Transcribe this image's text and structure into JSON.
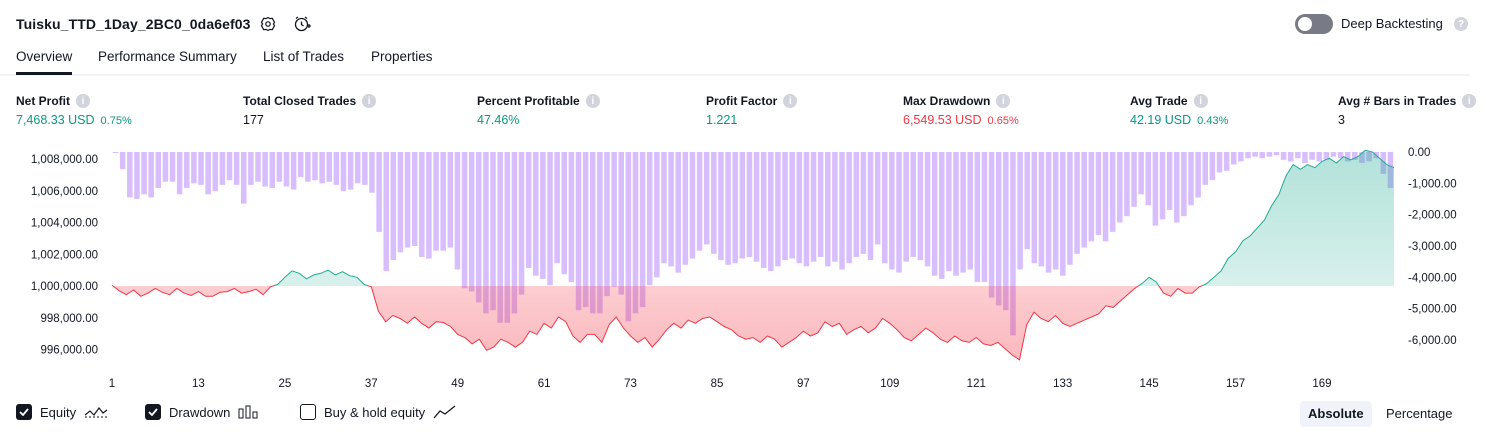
{
  "header": {
    "title": "Tuisku_TTD_1Day_2BC0_0da6ef03",
    "deep_backtesting_label": "Deep Backtesting"
  },
  "tabs": [
    {
      "label": "Overview",
      "active": true
    },
    {
      "label": "Performance Summary",
      "active": false
    },
    {
      "label": "List of Trades",
      "active": false
    },
    {
      "label": "Properties",
      "active": false
    }
  ],
  "metrics": [
    {
      "label": "Net Profit",
      "value": "7,468.33 USD",
      "pct": "0.75%",
      "color": "green"
    },
    {
      "label": "Total Closed Trades",
      "value": "177",
      "pct": "",
      "color": "dark"
    },
    {
      "label": "Percent Profitable",
      "value": "47.46%",
      "pct": "",
      "color": "green"
    },
    {
      "label": "Profit Factor",
      "value": "1.221",
      "pct": "",
      "color": "green"
    },
    {
      "label": "Max Drawdown",
      "value": "6,549.53 USD",
      "pct": "0.65%",
      "color": "red"
    },
    {
      "label": "Avg Trade",
      "value": "42.19 USD",
      "pct": "0.43%",
      "color": "green"
    },
    {
      "label": "Avg # Bars in Trades",
      "value": "3",
      "pct": "",
      "color": "dark"
    }
  ],
  "chart_data": {
    "type": "area",
    "baseline": 1000000,
    "left_axis": {
      "labels": [
        "1,008,000.00",
        "1,006,000.00",
        "1,004,000.00",
        "1,002,000.00",
        "1,000,000.00",
        "998,000.00",
        "996,000.00"
      ],
      "values": [
        1008000,
        1006000,
        1004000,
        1002000,
        1000000,
        998000,
        996000
      ]
    },
    "right_axis": {
      "labels": [
        "0.00",
        "-1,000.00",
        "-2,000.00",
        "-3,000.00",
        "-4,000.00",
        "-5,000.00",
        "-6,000.00"
      ],
      "values": [
        0,
        -1000,
        -2000,
        -3000,
        -4000,
        -5000,
        -6000
      ]
    },
    "x_ticks": [
      "1",
      "13",
      "25",
      "37",
      "49",
      "61",
      "73",
      "85",
      "97",
      "109",
      "121",
      "133",
      "145",
      "157",
      "169"
    ],
    "equity": [
      1000050,
      999700,
      999450,
      999750,
      999350,
      999550,
      999850,
      999600,
      999450,
      999850,
      999550,
      999400,
      999650,
      999350,
      999350,
      999600,
      999650,
      999850,
      999550,
      999650,
      999800,
      999450,
      999950,
      1000100,
      1000550,
      1000950,
      1000800,
      1000450,
      1000700,
      1000800,
      1001000,
      1000700,
      1000900,
      1000650,
      1000550,
      1000100,
      999950,
      998400,
      997750,
      998150,
      997950,
      997650,
      998050,
      997650,
      997350,
      997750,
      997700,
      997450,
      996950,
      996750,
      996350,
      996650,
      995950,
      996150,
      996650,
      996450,
      996150,
      996450,
      997150,
      996950,
      997650,
      997350,
      998050,
      997750,
      996850,
      996450,
      996950,
      996950,
      996450,
      997550,
      998050,
      997350,
      996850,
      996450,
      996750,
      996150,
      996650,
      997250,
      997650,
      997350,
      997850,
      997650,
      997950,
      998050,
      997750,
      997450,
      997250,
      996850,
      996650,
      996750,
      996450,
      996850,
      996650,
      996150,
      996450,
      996750,
      997150,
      996850,
      997050,
      997750,
      997450,
      997650,
      996950,
      997250,
      997450,
      997050,
      997350,
      997950,
      997650,
      997250,
      996750,
      996550,
      996950,
      997350,
      997050,
      996650,
      996450,
      996850,
      996550,
      996450,
      996750,
      996350,
      996250,
      996450,
      996050,
      995650,
      995350,
      997550,
      998350,
      997950,
      997750,
      998150,
      997650,
      997450,
      997650,
      997850,
      998050,
      998250,
      998750,
      998650,
      999050,
      999450,
      999850,
      1000150,
      1000550,
      1000250,
      999550,
      999350,
      999850,
      999550,
      999550,
      999950,
      1000150,
      1000550,
      1000950,
      1001750,
      1002150,
      1002850,
      1003150,
      1003650,
      1004150,
      1005050,
      1005750,
      1006950,
      1007650,
      1007350,
      1007650,
      1007450,
      1007850,
      1008050,
      1007750,
      1008150,
      1007950,
      1008150,
      1008550,
      1008450,
      1008050,
      1007650,
      1007450
    ],
    "drawdown": [
      0,
      -550,
      -1450,
      -1500,
      -1350,
      -1450,
      -1150,
      -950,
      -950,
      -1350,
      -1150,
      -1000,
      -1050,
      -1350,
      -1250,
      -1050,
      -900,
      -1050,
      -1650,
      -1050,
      -950,
      -1100,
      -1150,
      -950,
      -1100,
      -1200,
      -800,
      -950,
      -900,
      -1000,
      -950,
      -1050,
      -1250,
      -1200,
      -1000,
      -1050,
      -1300,
      -2550,
      -3800,
      -3450,
      -3200,
      -3050,
      -3000,
      -3350,
      -3400,
      -3150,
      -3150,
      -3050,
      -3750,
      -4350,
      -4450,
      -4800,
      -5150,
      -5050,
      -5450,
      -5450,
      -5150,
      -4550,
      -3700,
      -3950,
      -4050,
      -4250,
      -3550,
      -3900,
      -4150,
      -5050,
      -4950,
      -5150,
      -5150,
      -4600,
      -4300,
      -4550,
      -5400,
      -5150,
      -4950,
      -4250,
      -4000,
      -3550,
      -3650,
      -3850,
      -3600,
      -3400,
      -3150,
      -2950,
      -3250,
      -3450,
      -3600,
      -3550,
      -3400,
      -3350,
      -3500,
      -3700,
      -3800,
      -3650,
      -3450,
      -3400,
      -3550,
      -3650,
      -3500,
      -3350,
      -3650,
      -3500,
      -3750,
      -3550,
      -3350,
      -3250,
      -3450,
      -2950,
      -3550,
      -3750,
      -3850,
      -3500,
      -3350,
      -3450,
      -3650,
      -3950,
      -4050,
      -3800,
      -3950,
      -3850,
      -3750,
      -4150,
      -4150,
      -4650,
      -4900,
      -5050,
      -5850,
      -3750,
      -3100,
      -3550,
      -3650,
      -3850,
      -3750,
      -3950,
      -3600,
      -3250,
      -3050,
      -2850,
      -2650,
      -2850,
      -2550,
      -2250,
      -2050,
      -1750,
      -1350,
      -1700,
      -2350,
      -2150,
      -1850,
      -2250,
      -2050,
      -1700,
      -1450,
      -1050,
      -900,
      -650,
      -600,
      -400,
      -300,
      -200,
      -150,
      -200,
      -150,
      -100,
      -250,
      -300,
      -200,
      -350,
      -250,
      -300,
      -250,
      -150,
      -200,
      -300,
      -250,
      -350,
      -300,
      -200,
      -700,
      -1150
    ],
    "legend": [
      {
        "label": "Equity",
        "checked": true
      },
      {
        "label": "Drawdown",
        "checked": true
      },
      {
        "label": "Buy & hold equity",
        "checked": false
      }
    ],
    "colors": {
      "equity_up": "#22ab94",
      "equity_down": "#f23645",
      "drawdown": "#d1b3ff"
    }
  },
  "scale_toggle": {
    "absolute": "Absolute",
    "percentage": "Percentage",
    "active": "absolute"
  }
}
